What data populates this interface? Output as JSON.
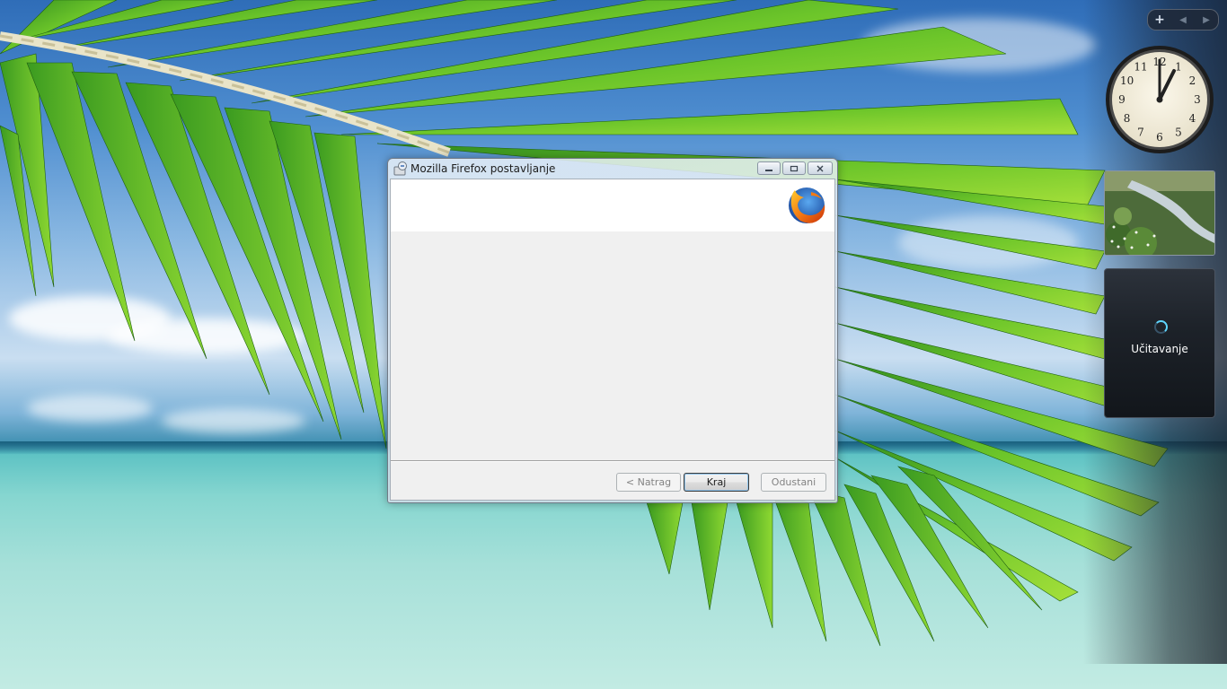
{
  "window": {
    "title": "Mozilla Firefox postavljanje",
    "buttons": {
      "back": "< Natrag",
      "finish": "Kraj",
      "cancel": "Odustani"
    }
  },
  "sidebar": {
    "controls": {
      "add": "+",
      "prev": "◀",
      "next": "▶"
    },
    "clock": {
      "numerals": [
        "12",
        "1",
        "2",
        "3",
        "4",
        "5",
        "6",
        "7",
        "8",
        "9",
        "10",
        "11"
      ]
    },
    "loading_gadget": {
      "text": "Učitavanje"
    }
  },
  "colors": {
    "accent_spinner": "#5fd6ff",
    "firefox_orange": "#e66000",
    "firefox_blue": "#1c4da1"
  }
}
